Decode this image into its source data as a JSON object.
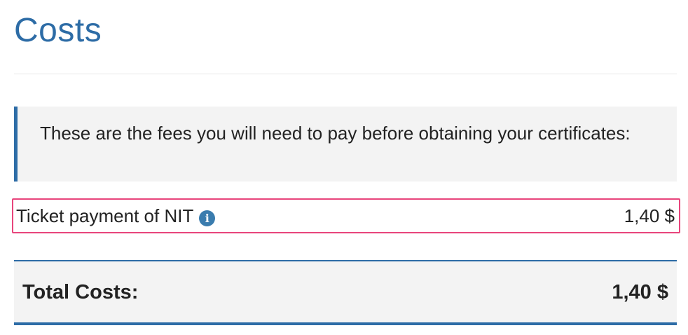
{
  "page": {
    "title": "Costs"
  },
  "notice": {
    "text": "These are the fees you will need to pay before obtaining your certificates:"
  },
  "fees": [
    {
      "label": "Ticket payment of NIT",
      "info_icon": "info-circle-icon",
      "amount": "1,40 $"
    }
  ],
  "total": {
    "label": "Total Costs:",
    "amount": "1,40 $"
  },
  "colors": {
    "accent": "#2d6ca6",
    "highlight_border": "#e8457c",
    "panel_background": "#f3f3f3"
  }
}
